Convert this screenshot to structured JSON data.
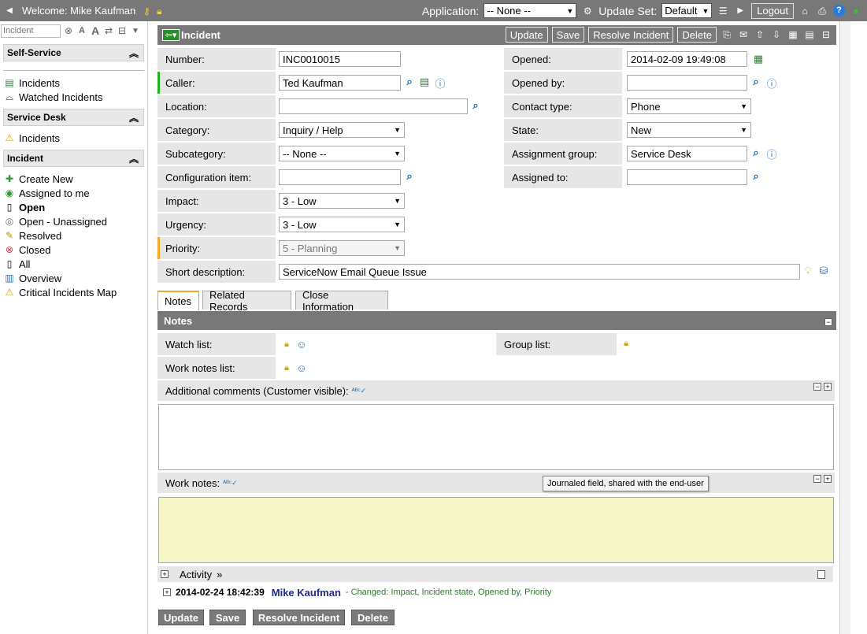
{
  "banner": {
    "welcome": "Welcome: Mike Kaufman",
    "application_label": "Application:",
    "application_value": "-- None --",
    "update_set_label": "Update Set:",
    "update_set_value": "Default",
    "logout": "Logout"
  },
  "nav": {
    "filter_placeholder": "Incident",
    "self_service": {
      "title": "Self-Service",
      "items": [
        "Incidents",
        "Watched Incidents"
      ]
    },
    "service_desk": {
      "title": "Service Desk",
      "items": [
        "Incidents"
      ]
    },
    "incident": {
      "title": "Incident",
      "items": [
        "Create New",
        "Assigned to me",
        "Open",
        "Open - Unassigned",
        "Resolved",
        "Closed",
        "All",
        "Overview",
        "Critical Incidents Map"
      ]
    }
  },
  "form": {
    "title": "Incident",
    "buttons": {
      "update": "Update",
      "save": "Save",
      "resolve": "Resolve Incident",
      "delete": "Delete"
    },
    "fields": {
      "number": {
        "label": "Number:",
        "value": "INC0010015"
      },
      "caller": {
        "label": "Caller:",
        "value": "Ted Kaufman"
      },
      "location": {
        "label": "Location:",
        "value": ""
      },
      "category": {
        "label": "Category:",
        "value": "Inquiry / Help"
      },
      "subcategory": {
        "label": "Subcategory:",
        "value": "-- None --"
      },
      "configuration_item": {
        "label": "Configuration item:",
        "value": ""
      },
      "impact": {
        "label": "Impact:",
        "value": "3 - Low"
      },
      "urgency": {
        "label": "Urgency:",
        "value": "3 - Low"
      },
      "priority": {
        "label": "Priority:",
        "value": "5 - Planning"
      },
      "short_description": {
        "label": "Short description:",
        "value": "ServiceNow Email Queue Issue"
      },
      "opened": {
        "label": "Opened:",
        "value": "2014-02-09 19:49:08"
      },
      "opened_by": {
        "label": "Opened by:",
        "value": ""
      },
      "contact_type": {
        "label": "Contact type:",
        "value": "Phone"
      },
      "state": {
        "label": "State:",
        "value": "New"
      },
      "assignment_group": {
        "label": "Assignment group:",
        "value": "Service Desk"
      },
      "assigned_to": {
        "label": "Assigned to:",
        "value": ""
      }
    },
    "tabs": [
      "Notes",
      "Related Records",
      "Close Information"
    ],
    "notes": {
      "section_title": "Notes",
      "watch_list": "Watch list:",
      "group_list": "Group list:",
      "work_notes_list": "Work notes list:",
      "additional_comments": "Additional comments (Customer visible):",
      "work_notes": "Work notes:",
      "tooltip": "Journaled field, shared with the end-user"
    },
    "activity": {
      "label": "Activity",
      "entry_time": "2014-02-24 18:42:39",
      "entry_user": "Mike Kaufman",
      "entry_text": "- Changed:  Impact, Incident state, Opened by, Priority"
    }
  }
}
